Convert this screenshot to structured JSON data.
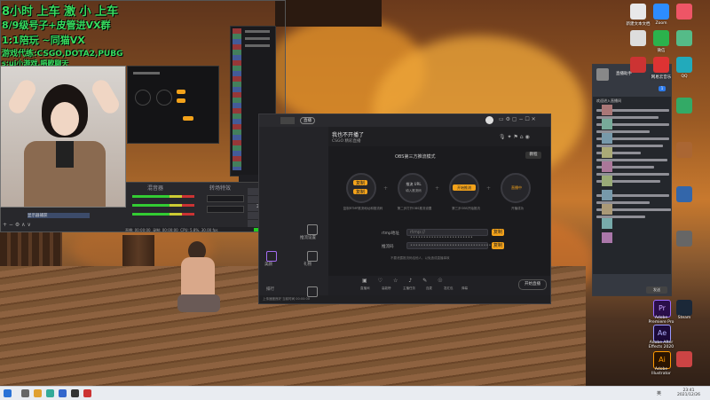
{
  "overlay": {
    "line1": "8小时 上车 激 小 上车",
    "line2": "8/9级号子+皮管进VX群",
    "line3": "1:1陪玩 ~同猫VX",
    "line4": "游戏代练:CSGO,DOTA2,PUBG",
    "line5": "s:ui小游戏,唱歌聊天"
  },
  "obs_main": {
    "scene_label": "场景",
    "source_label": "来源",
    "mixer_label": "混音器",
    "transition_label": "转场特效",
    "control_label": "控制",
    "controls": [
      "开始推流",
      "开始录制",
      "工作室模式",
      "设置",
      "退出"
    ],
    "status_items": [
      "直播: 00:00:00",
      "录制: 00:00:00",
      "CPU: 5.8%, 30.00 fps"
    ],
    "webcam_scene": "显示器捕获"
  },
  "streamer": {
    "title": "我也不开播了",
    "tag": "直播",
    "subtitle": "CSGO  精彩直播",
    "flow_title": "OBS第三方推流模式",
    "tutorial_btn": "教程",
    "steps": [
      {
        "label": "复制RTMP推流地址和推流码",
        "btn1": "复制",
        "btn2": "复制"
      },
      {
        "label": "第二步打开OBS推流设置",
        "center": "推流 URL",
        "sub": "填入推流码"
      },
      {
        "label": "第三步OBS开始推流",
        "center": "开始推流"
      },
      {
        "label": "开播成功",
        "center": "直播中"
      }
    ],
    "rtmp_label": "rtmp地址",
    "rtmp_value": "rtmp://••••••••••••••••••••••••",
    "rtmp_copy": "复制",
    "key_label": "推流码",
    "key_value": "••••••••••••••••••••••••••••••••",
    "key_copy": "复制",
    "notice": "不要泄露推流码给他人，以免造成直播事故",
    "toolbar": [
      "直播间",
      "高能榜",
      "主播任务",
      "连麦",
      "发红包",
      "弹幕",
      "设置",
      "更多"
    ],
    "end_btn": "开始直播",
    "bottom_status": "上传速度良好 当前时间 00:00:00",
    "side_items": [
      "推流设置",
      "美颜",
      "礼物",
      "排行"
    ]
  },
  "chat": {
    "title": "直播助手",
    "count": "1",
    "messages_title": "欢迎进入直播间",
    "footer": "发送",
    "friends": [
      "好友1",
      "好友2",
      "好友3",
      "好友4",
      "好友5",
      "好友6",
      "好友7",
      "好友8",
      "好友9",
      "好友10"
    ]
  },
  "desktop_icons": [
    {
      "label": "新建文本文档"
    },
    {
      "label": "Adobe Premiere Pro"
    },
    {
      "label": "Adobe After Effects 2020"
    },
    {
      "label": "Adobe Illustrator"
    },
    {
      "label": "Steam"
    },
    {
      "label": "Zoom"
    },
    {
      "label": "网易云音乐"
    },
    {
      "label": "微信"
    },
    {
      "label": "QQ"
    }
  ],
  "taskbar": {
    "time": "23:41",
    "date": "2021/12/26",
    "lang": "英"
  },
  "colors": {
    "accent": "#f3a21a",
    "green_overlay": "#3bff6a",
    "dark_panel": "#1f1f22"
  }
}
